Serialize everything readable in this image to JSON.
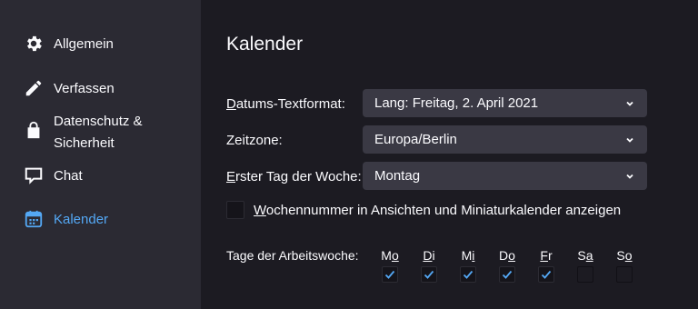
{
  "sidebar": {
    "items": [
      {
        "label": "Allgemein",
        "icon": "gear-icon"
      },
      {
        "label": "Verfassen",
        "icon": "pencil-icon"
      },
      {
        "label_line1": "Datenschutz &",
        "label_line2": "Sicherheit",
        "icon": "lock-icon"
      },
      {
        "label": "Chat",
        "icon": "chat-bubble-icon"
      },
      {
        "label": "Kalender",
        "icon": "calendar-icon",
        "active": true
      }
    ],
    "active_color": "#54a8f5"
  },
  "main": {
    "title": "Kalender",
    "date_format": {
      "label_access": "D",
      "label_rest": "atums-Textformat:",
      "value": "Lang: Freitag, 2. April 2021"
    },
    "timezone": {
      "label": "Zeitzone:",
      "value": "Europa/Berlin"
    },
    "first_day": {
      "label_access": "E",
      "label_rest": "rster Tag der Woche:",
      "value": "Montag"
    },
    "week_numbers": {
      "label_access": "W",
      "label_rest": "ochennummer in Ansichten und Miniaturkalender anzeigen",
      "checked": false
    },
    "workdays": {
      "label": "Tage der Arbeitswoche:",
      "days": [
        {
          "pre": "M",
          "acc": "o",
          "post": "",
          "checked": true
        },
        {
          "pre": "",
          "acc": "D",
          "post": "i",
          "checked": true
        },
        {
          "pre": "M",
          "acc": "i",
          "post": "",
          "checked": true
        },
        {
          "pre": "D",
          "acc": "o",
          "post": "",
          "checked": true
        },
        {
          "pre": "",
          "acc": "F",
          "post": "r",
          "checked": true
        },
        {
          "pre": "S",
          "acc": "a",
          "post": "",
          "checked": false
        },
        {
          "pre": "S",
          "acc": "o",
          "post": "",
          "checked": false
        }
      ]
    }
  },
  "colors": {
    "background": "#1c1b22",
    "sidebar": "#2b2a33",
    "select": "#3a3944",
    "check_accent": "#54a8f5"
  }
}
